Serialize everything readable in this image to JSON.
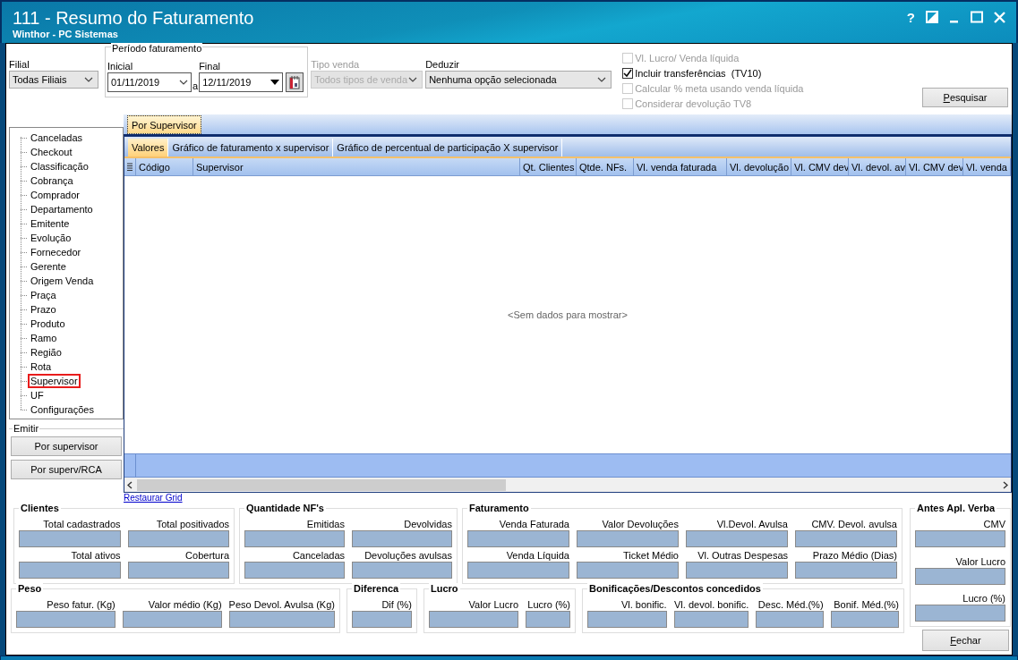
{
  "window": {
    "title": "111 - Resumo do Faturamento",
    "subtitle": "Winthor - PC Sistemas",
    "help": "?"
  },
  "filters": {
    "filial": {
      "label": "Filial",
      "value": "Todas Filiais"
    },
    "periodo": {
      "legend": "Período faturamento",
      "inicial": {
        "label": "Inicial",
        "value": "01/11/2019"
      },
      "separator": "a",
      "final": {
        "label": "Final",
        "value": "12/11/2019"
      }
    },
    "tipo_venda": {
      "label": "Tipo venda",
      "value": "Todos tipos de venda",
      "disabled": true
    },
    "deduzir": {
      "label": "Deduzir",
      "value": "Nenhuma opção selecionada"
    },
    "options": [
      {
        "label": "Vl. Lucro/ Venda líquida",
        "checked": false,
        "disabled": true
      },
      {
        "label": "Incluir transferências  (TV10)",
        "checked": true,
        "disabled": false
      },
      {
        "label": "Calcular % meta usando venda líquida",
        "checked": false,
        "disabled": true
      },
      {
        "label": "Considerar devolução TV8",
        "checked": false,
        "disabled": true
      }
    ],
    "search_button": "Pesquisar"
  },
  "sidebar": {
    "items": [
      {
        "label": "Canceladas",
        "selected": false
      },
      {
        "label": "Checkout",
        "selected": false
      },
      {
        "label": "Classificação",
        "selected": false
      },
      {
        "label": "Cobrança",
        "selected": false
      },
      {
        "label": "Comprador",
        "selected": false
      },
      {
        "label": "Departamento",
        "selected": false
      },
      {
        "label": "Emitente",
        "selected": false
      },
      {
        "label": "Evolução",
        "selected": false
      },
      {
        "label": "Fornecedor",
        "selected": false
      },
      {
        "label": "Gerente",
        "selected": false
      },
      {
        "label": "Origem Venda",
        "selected": false
      },
      {
        "label": "Praça",
        "selected": false
      },
      {
        "label": "Prazo",
        "selected": false
      },
      {
        "label": "Produto",
        "selected": false
      },
      {
        "label": "Ramo",
        "selected": false
      },
      {
        "label": "Região",
        "selected": false
      },
      {
        "label": "Rota",
        "selected": false
      },
      {
        "label": "Supervisor",
        "selected": true
      },
      {
        "label": "UF",
        "selected": false
      },
      {
        "label": "Configurações",
        "selected": false
      }
    ],
    "emit": {
      "legend": "Emitir",
      "buttons": [
        "Por supervisor",
        "Por superv/RCA"
      ]
    }
  },
  "outer_tabs": [
    {
      "label": "Por Supervisor",
      "selected": true
    }
  ],
  "inner_tabs": [
    {
      "label": "Valores",
      "selected": true
    },
    {
      "label": "Gráfico de faturamento x supervisor",
      "selected": false
    },
    {
      "label": "Gráfico de percentual de participação X supervisor",
      "selected": false
    }
  ],
  "table": {
    "columns": [
      "Código",
      "Supervisor",
      "Qt. Clientes",
      "Qtde. NFs.",
      "Vl. venda faturada",
      "Vl. devolução",
      "Vl. CMV dev",
      "Vl. devol. av",
      "Vl. CMV dev",
      "Vl. venda"
    ],
    "empty_message": "<Sem dados para mostrar>"
  },
  "restore_link": "Restaurar Grid",
  "summary": {
    "top_groups": [
      {
        "title": "Clientes",
        "fields": [
          "Total cadastrados",
          "Total positivados",
          "Total ativos",
          "Cobertura"
        ]
      },
      {
        "title": "Quantidade NF's",
        "fields": [
          "Emitidas",
          "Devolvidas",
          "Canceladas",
          "Devoluções avulsas"
        ]
      },
      {
        "title": "Faturamento",
        "fields": [
          "Venda Faturada",
          "Valor Devoluções",
          "Vl.Devol. Avulsa",
          "CMV. Devol. avulsa",
          "Venda Líquida",
          "Ticket Médio",
          "Vl. Outras Despesas",
          "Prazo Médio (Dias)"
        ]
      }
    ],
    "bottom_groups": [
      {
        "title": "Peso",
        "fields": [
          "Peso fatur. (Kg)",
          "Valor médio (Kg)",
          "Peso Devol. Avulsa (Kg)"
        ]
      },
      {
        "title": "Diferenca",
        "fields": [
          "Dif (%)"
        ]
      },
      {
        "title": "Lucro",
        "fields": [
          "Valor Lucro",
          "Lucro (%)"
        ]
      },
      {
        "title": "Bonificações/Descontos concedidos",
        "fields": [
          "Vl. bonific.",
          "Vl. devol. bonific.",
          "Desc. Méd.(%)",
          "Bonif. Méd.(%)"
        ]
      }
    ],
    "side_group": {
      "title": "Antes Apl. Verba",
      "fields": [
        "CMV",
        "Valor Lucro",
        "Lucro (%)"
      ]
    }
  },
  "close_button": "Fechar"
}
